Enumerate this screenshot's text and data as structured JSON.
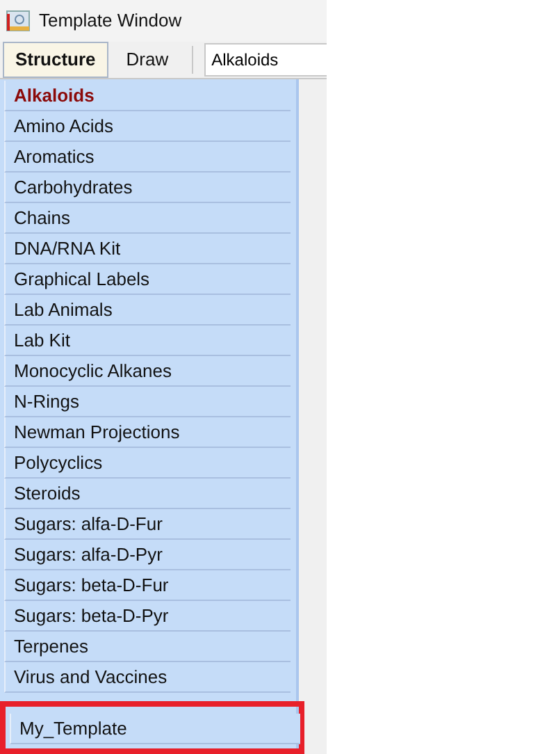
{
  "window": {
    "title": "Template Window"
  },
  "tabs": [
    {
      "label": "Structure",
      "selected": true
    },
    {
      "label": "Draw",
      "selected": false
    }
  ],
  "template_select": {
    "value": "Alkaloids"
  },
  "categories": [
    {
      "label": "Alkaloids",
      "selected": true,
      "highlighted": false
    },
    {
      "label": "Amino Acids",
      "selected": false,
      "highlighted": false
    },
    {
      "label": "Aromatics",
      "selected": false,
      "highlighted": false
    },
    {
      "label": "Carbohydrates",
      "selected": false,
      "highlighted": false
    },
    {
      "label": "Chains",
      "selected": false,
      "highlighted": false
    },
    {
      "label": "DNA/RNA Kit",
      "selected": false,
      "highlighted": false
    },
    {
      "label": "Graphical Labels",
      "selected": false,
      "highlighted": false
    },
    {
      "label": "Lab Animals",
      "selected": false,
      "highlighted": false
    },
    {
      "label": "Lab Kit",
      "selected": false,
      "highlighted": false
    },
    {
      "label": "Monocyclic Alkanes",
      "selected": false,
      "highlighted": false
    },
    {
      "label": "N-Rings",
      "selected": false,
      "highlighted": false
    },
    {
      "label": "Newman Projections",
      "selected": false,
      "highlighted": false
    },
    {
      "label": "Polycyclics",
      "selected": false,
      "highlighted": false
    },
    {
      "label": "Steroids",
      "selected": false,
      "highlighted": false
    },
    {
      "label": "Sugars: alfa-D-Fur",
      "selected": false,
      "highlighted": false
    },
    {
      "label": "Sugars: alfa-D-Pyr",
      "selected": false,
      "highlighted": false
    },
    {
      "label": "Sugars: beta-D-Fur",
      "selected": false,
      "highlighted": false
    },
    {
      "label": "Sugars: beta-D-Pyr",
      "selected": false,
      "highlighted": false
    },
    {
      "label": "Terpenes",
      "selected": false,
      "highlighted": false
    },
    {
      "label": "Virus and Vaccines",
      "selected": false,
      "highlighted": false
    },
    {
      "label": "My_Template",
      "selected": false,
      "highlighted": true
    }
  ]
}
